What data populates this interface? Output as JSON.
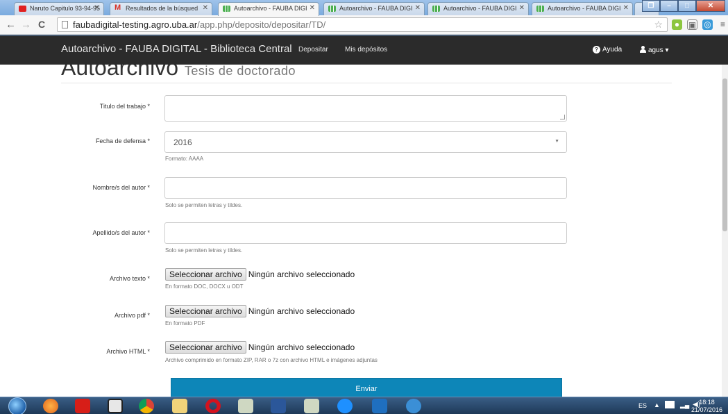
{
  "browser": {
    "tabs": [
      {
        "title": "Naruto Capitulo 93-94-95",
        "icon": "youtube-icon"
      },
      {
        "title": "Resultados de la búsqued",
        "icon": "gmail-icon"
      },
      {
        "title": "Autoarchivo - FAUBA DIGI",
        "icon": "sheet-icon",
        "active": true
      },
      {
        "title": "Autoarchivo - FAUBA DIGI",
        "icon": "sheet-icon"
      },
      {
        "title": "Autoarchivo - FAUBA DIGI",
        "icon": "sheet-icon"
      },
      {
        "title": "Autoarchivo - FAUBA DIGI",
        "icon": "sheet-icon"
      }
    ],
    "url_host": "faubadigital-testing.agro.uba.ar",
    "url_path": "/app.php/deposito/depositar/TD/"
  },
  "navbar": {
    "brand": "Autoarchivo - FAUBA DIGITAL - Biblioteca Central",
    "links": [
      "Depositar",
      "Mis depósitos"
    ],
    "help": "Ayuda",
    "user": "agus",
    "user_caret": "▾"
  },
  "page": {
    "title": "Autoarchivo",
    "subtitle": "Tesis de doctorado"
  },
  "form": {
    "titulo": {
      "label": "Titulo del trabajo *",
      "value": ""
    },
    "fecha": {
      "label": "Fecha de defensa *",
      "value": "2016",
      "help": "Formato: AAAA"
    },
    "nombre": {
      "label": "Nombre/s del autor *",
      "value": "",
      "help": "Solo se permiten letras y tildes."
    },
    "apellido": {
      "label": "Apellido/s del autor *",
      "value": "",
      "help": "Solo se permiten letras y tildes."
    },
    "archivo_texto": {
      "label": "Archivo texto *",
      "button": "Seleccionar archivo",
      "status": "Ningún archivo seleccionado",
      "help": "En formato DOC, DOCX u ODT"
    },
    "archivo_pdf": {
      "label": "Archivo pdf *",
      "button": "Seleccionar archivo",
      "status": "Ningún archivo seleccionado",
      "help": "En formato PDF"
    },
    "archivo_html": {
      "label": "Archivo HTML *",
      "button": "Seleccionar archivo",
      "status": "Ningún archivo seleccionado",
      "help": "Archivo comprimido en formato ZIP, RAR o 7z con archivo HTML e imágenes adjuntas"
    },
    "submit": "Enviar"
  },
  "taskbar": {
    "lang": "ES",
    "time": "18:18",
    "date": "21/07/2016",
    "icons": [
      "firefox-icon",
      "acrobat-icon",
      "media-player-icon",
      "chrome-icon",
      "file-explorer-icon",
      "opera-icon",
      "app-icon",
      "word-icon",
      "app-icon",
      "internet-explorer-icon",
      "media-icon",
      "app-icon"
    ]
  }
}
